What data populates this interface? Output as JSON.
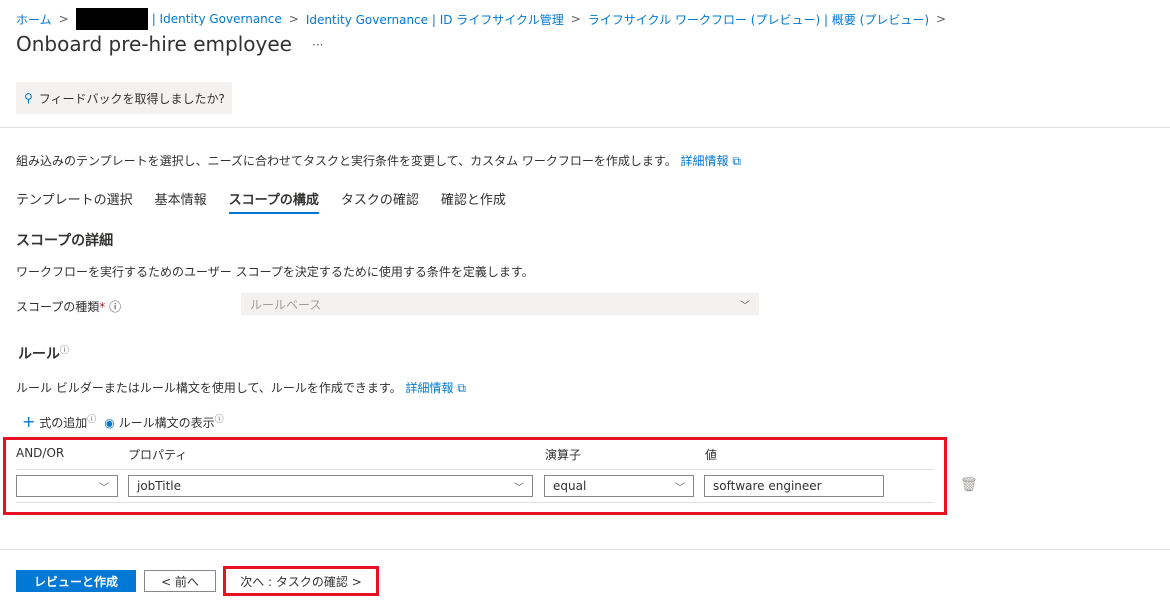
{
  "breadcrumb": [
    "ホーム",
    "| Identity Governance",
    "Identity Governance | ID ライフサイクル管理",
    "ライフサイクル ワークフロー (プレビュー) | 概要 (プレビュー)"
  ],
  "title": "Onboard pre-hire employee",
  "more": "···",
  "feedback": "フィードバックを取得しましたか?",
  "intro": "組み込みのテンプレートを選択し、ニーズに合わせてタスクと実行条件を変更して、カスタム ワークフローを作成します。",
  "learn_more": "詳細情報",
  "tabs": [
    "テンプレートの選択",
    "基本情報",
    "スコープの構成",
    "タスクの確認",
    "確認と作成"
  ],
  "scope": {
    "heading": "スコープの詳細",
    "desc": "ワークフローを実行するためのユーザー スコープを決定するために使用する条件を定義します。",
    "type_label": "スコープの種類",
    "required": "*",
    "type_value": "ルールベース"
  },
  "rules": {
    "heading": "ルール",
    "desc": "ルール ビルダーまたはルール構文を使用して、ルールを作成できます。",
    "learn_more": "詳細情報",
    "add": "式の追加",
    "show_syntax": "ルール構文の表示",
    "columns": [
      "AND/OR",
      "プロパティ",
      "演算子",
      "値"
    ],
    "row": {
      "andor": "",
      "property": "jobTitle",
      "operator": "equal",
      "value": "software engineer"
    }
  },
  "footer": {
    "review": "レビューと作成",
    "prev": "< 前へ",
    "next": "次へ : タスクの確認 >"
  }
}
